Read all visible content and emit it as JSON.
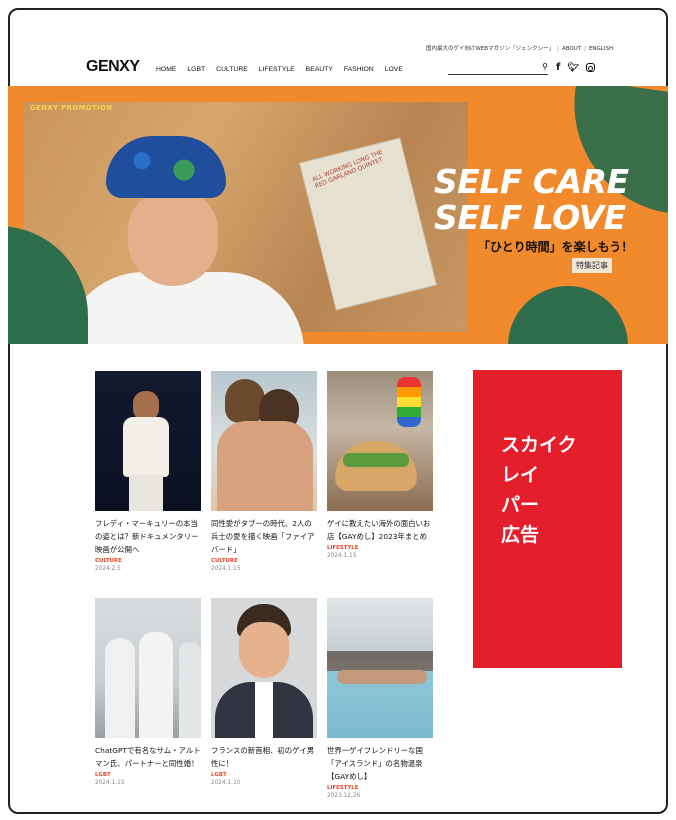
{
  "header": {
    "top_note": "国内最大のゲイ向けWEBマガジン「ジェンクシー」",
    "about": "ABOUT",
    "english": "ENGLISH",
    "logo": "GENXY",
    "nav": [
      "HOME",
      "LGBT",
      "CULTURE",
      "LIFESTYLE",
      "BEAUTY",
      "FASHION",
      "LOVE"
    ],
    "search_placeholder": "",
    "search_icon": "magnifier-icon",
    "social_icons": [
      "facebook-icon",
      "twitter-icon",
      "instagram-icon"
    ]
  },
  "hero": {
    "promo": "GENXY PROMOTION",
    "headline_1": "SELF CARE",
    "headline_2": "SELF LOVE",
    "subtitle": "「ひとり時間」を楽しもう！",
    "badge": "特集記事",
    "record_text": "ALL WORKING LONG THE RED GARLAND QUINTET"
  },
  "articles": [
    {
      "title": "フレディ・マーキュリーの本当の姿とは？新ドキュメンタリー映画が公開へ",
      "category": "CULTURE",
      "date": "2024.2.5"
    },
    {
      "title": "同性愛がタブーの時代、2人の兵士の愛を描く映画「ファイアバード」",
      "category": "CULTURE",
      "date": "2024.1.15"
    },
    {
      "title": "ゲイに教えたい海外の面白いお店【GAYめし】2023年まとめ",
      "category": "LIFESTYLE",
      "date": "2024.1.15"
    },
    {
      "title": "ChatGPTで有名なサム・アルトマン氏、パートナーと同性婚！",
      "category": "LGBT",
      "date": "2024.1.15"
    },
    {
      "title": "フランスの新首相、初のゲイ男性に！",
      "category": "LGBT",
      "date": "2024.1.10"
    },
    {
      "title": "世界一ゲイフレンドリーな国「アイスランド」の名物温泉【GAYめし】",
      "category": "LIFESTYLE",
      "date": "2023.12.26"
    }
  ],
  "ad": {
    "text_lines": [
      "スカイク",
      "レイ",
      "パー",
      "広告"
    ]
  },
  "colors": {
    "hero_bg": "#f08a2c",
    "accent": "#e8462a",
    "ad_bg": "#e41e2a",
    "leaf": "#2f6e4c"
  }
}
